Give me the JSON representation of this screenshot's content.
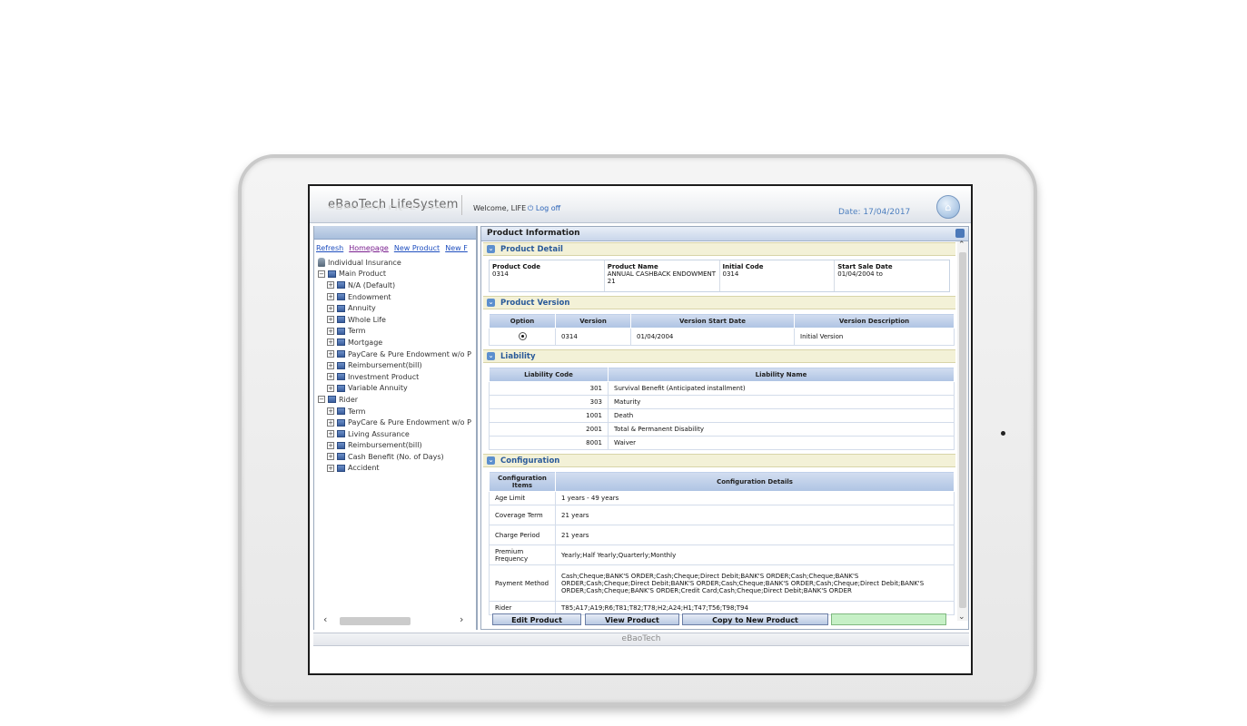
{
  "header": {
    "brand": "eBaoTech  LifeSystem",
    "welcome": "Welcome, LIFE",
    "logoff": "Log off",
    "date": "Date: 17/04/2017"
  },
  "left": {
    "links": [
      "Refresh",
      "Homepage",
      "New Product",
      "New F"
    ],
    "root": "Individual Insurance",
    "main_product": "Main Product",
    "main_items": [
      "N/A (Default)",
      "Endowment",
      "Annuity",
      "Whole Life",
      "Term",
      "Mortgage",
      "PayCare & Pure Endowment w/o P",
      "Reimbursement(bill)",
      "Investment Product",
      "Variable Annuity"
    ],
    "rider": "Rider",
    "rider_items": [
      "Term",
      "PayCare & Pure Endowment w/o P",
      "Living Assurance",
      "Reimbursement(bill)",
      "Cash Benefit (No. of Days)",
      "Accident"
    ]
  },
  "main": {
    "title": "Product Information",
    "sections": {
      "detail": "Product Detail",
      "version": "Product Version",
      "liability": "Liability",
      "config": "Configuration"
    },
    "detail": {
      "labels": [
        "Product Code",
        "Product Name",
        "Initial Code",
        "Start Sale Date"
      ],
      "values": [
        "0314",
        "ANNUAL CASHBACK ENDOWMENT 21",
        "0314",
        "01/04/2004 to"
      ]
    },
    "version": {
      "headers": [
        "Option",
        "Version",
        "Version Start Date",
        "Version Description"
      ],
      "row": {
        "version": "0314",
        "start": "01/04/2004",
        "desc": "Initial Version"
      }
    },
    "liability": {
      "headers": [
        "Liability Code",
        "Liability Name"
      ],
      "rows": [
        {
          "code": "301",
          "name": "Survival Benefit (Anticipated installment)"
        },
        {
          "code": "303",
          "name": "Maturity"
        },
        {
          "code": "1001",
          "name": "Death"
        },
        {
          "code": "2001",
          "name": "Total & Permanent Disability"
        },
        {
          "code": "8001",
          "name": "Waiver"
        }
      ]
    },
    "config": {
      "headers": [
        "Configuration Items",
        "Configuration Details"
      ],
      "rows": [
        {
          "item": "Age Limit",
          "detail": "1 years - 49 years"
        },
        {
          "item": "Coverage Term",
          "detail": "21 years"
        },
        {
          "item": "Charge Period",
          "detail": "21 years"
        },
        {
          "item": "Premium Frequency",
          "detail": "Yearly;Half Yearly;Quarterly;Monthly"
        },
        {
          "item": "Payment Method",
          "detail": "Cash;Cheque;BANK'S ORDER;Cash;Cheque;Direct Debit;BANK'S ORDER;Cash;Cheque;BANK'S ORDER;Cash;Cheque;Direct Debit;BANK'S ORDER;Cash;Cheque;BANK'S ORDER;Cash;Cheque;Direct Debit;BANK'S ORDER;Cash;Cheque;BANK'S ORDER;Credit Card;Cash;Cheque;Direct Debit;BANK'S ORDER"
        },
        {
          "item": "Rider",
          "detail": "T85;A17;A19;R6;T81;T82;T78;H2;A24;H1;T47;T56;T98;T94"
        }
      ]
    },
    "buttons": {
      "edit": "Edit Product",
      "view": "View Product",
      "copy": "Copy to New Product"
    }
  },
  "footer": "eBaoTech"
}
